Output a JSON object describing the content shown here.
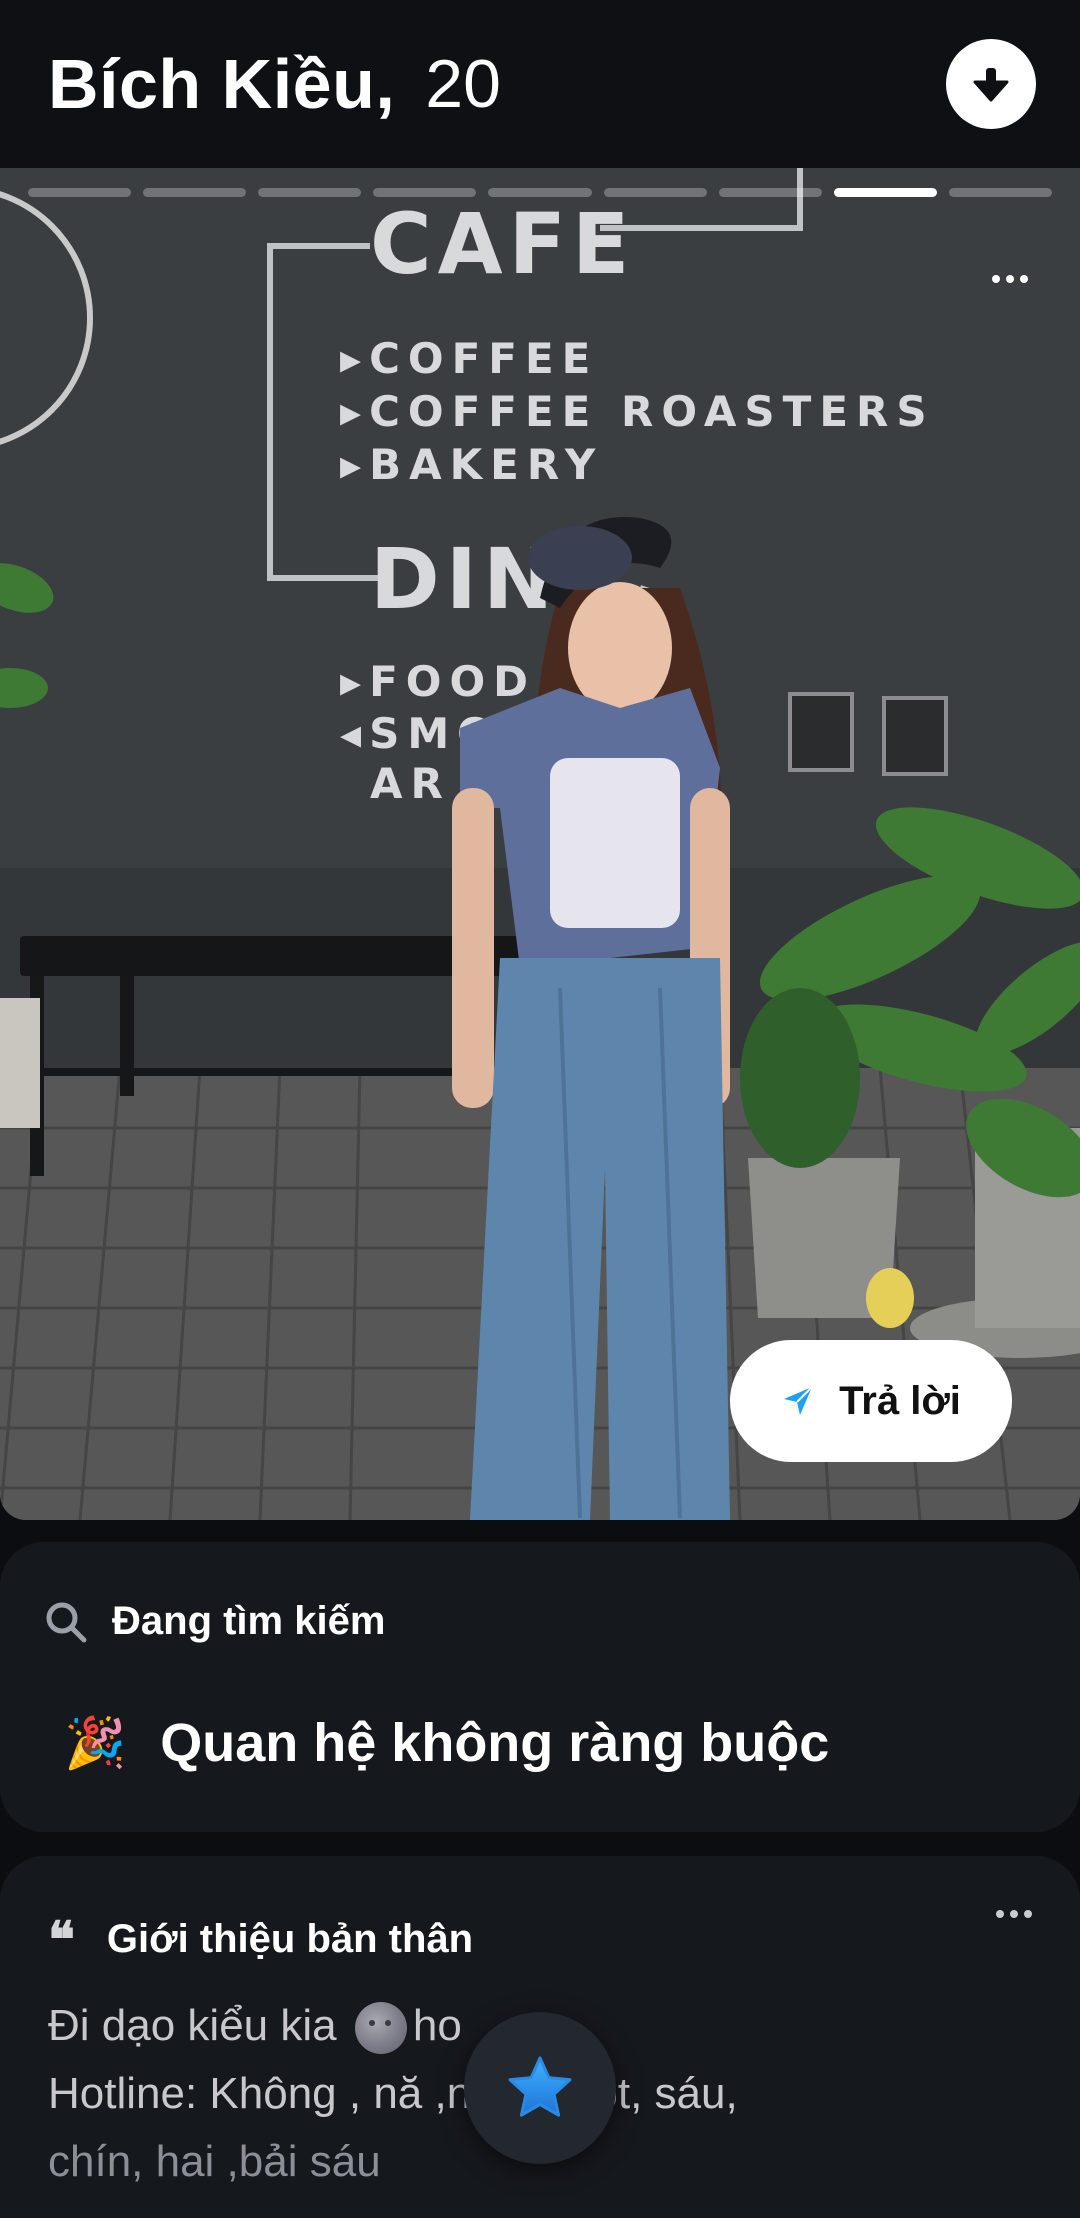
{
  "header": {
    "name": "Bích Kiều,",
    "age": "20"
  },
  "photo": {
    "total_photos": 9,
    "active_index": 8,
    "sign_texts": [
      "CAFE",
      "▸COFFEE",
      "▸COFFEE  ROASTERS",
      "▸BAKERY",
      "DINI",
      "▸FOOD",
      "◂SMO",
      "AR"
    ]
  },
  "reply": {
    "label": "Trả lời"
  },
  "seeking": {
    "label": "Đang tìm kiếm",
    "emoji": "🎉",
    "value": "Quan hệ không ràng buộc"
  },
  "about": {
    "label": "Giới thiệu bản thân",
    "quote_mark": "❝",
    "line1_before": "Đi dạo kiểu kia",
    "line1_after": "ho",
    "line2": "Hotline: Không , nă                  ,năm ,một, sáu,",
    "line3": "chín, hai ,bải sáu"
  },
  "icons": {
    "download": "arrow-down-icon",
    "send": "send-icon",
    "search": "search-icon",
    "star": "star-icon"
  },
  "colors": {
    "accent_blue": "#1da1f2",
    "star_blue": "#1e88e5"
  }
}
